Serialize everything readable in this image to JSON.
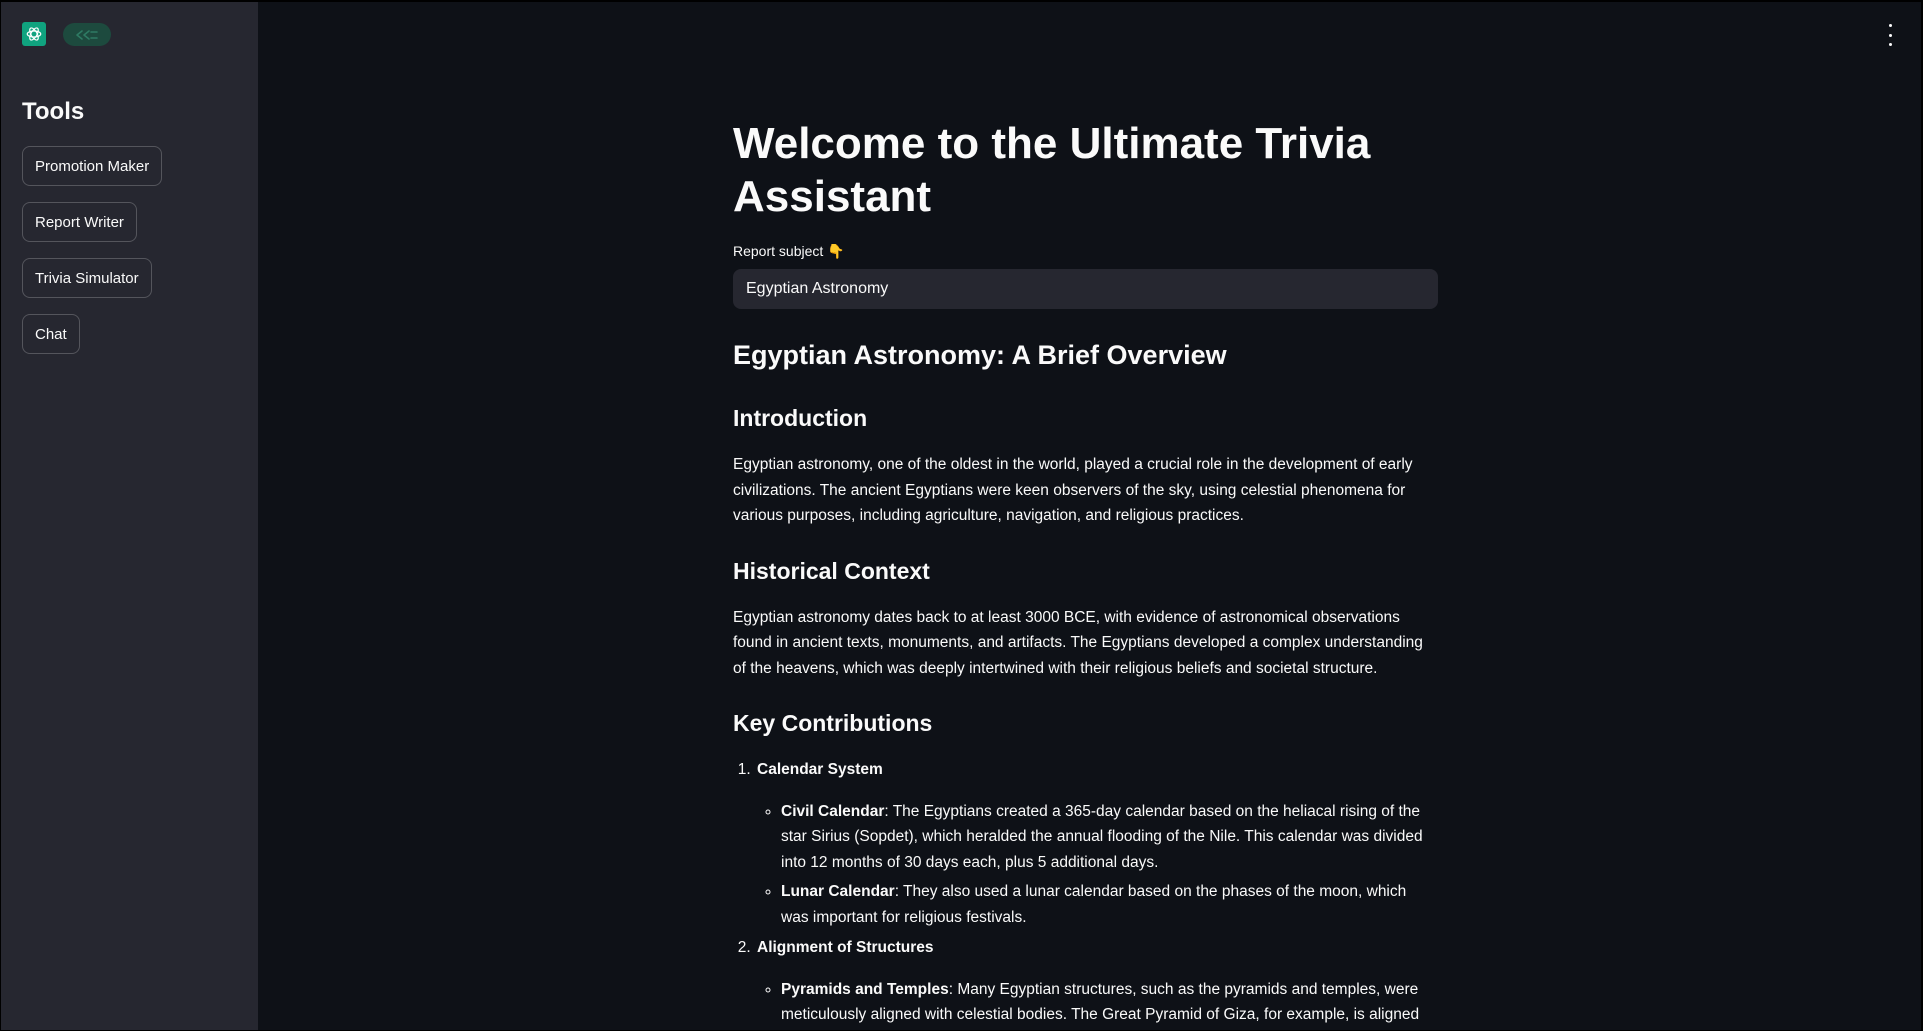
{
  "sidebar": {
    "title": "Tools",
    "buttons": [
      {
        "label": "Promotion Maker"
      },
      {
        "label": "Report Writer"
      },
      {
        "label": "Trivia Simulator"
      },
      {
        "label": "Chat"
      }
    ]
  },
  "main": {
    "title": "Welcome to the Ultimate Trivia Assistant",
    "input_label": "Report subject 👇",
    "input_value": "Egyptian Astronomy"
  },
  "report": {
    "heading": "Egyptian Astronomy: A Brief Overview",
    "sections": [
      {
        "heading": "Introduction",
        "body": "Egyptian astronomy, one of the oldest in the world, played a crucial role in the development of early civilizations. The ancient Egyptians were keen observers of the sky, using celestial phenomena for various purposes, including agriculture, navigation, and religious practices."
      },
      {
        "heading": "Historical Context",
        "body": "Egyptian astronomy dates back to at least 3000 BCE, with evidence of astronomical observations found in ancient texts, monuments, and artifacts. The Egyptians developed a complex understanding of the heavens, which was deeply intertwined with their religious beliefs and societal structure."
      }
    ],
    "contributions": {
      "heading": "Key Contributions",
      "items": [
        {
          "title": "Calendar System",
          "points": [
            {
              "term": "Civil Calendar",
              "text": ": The Egyptians created a 365-day calendar based on the heliacal rising of the star Sirius (Sopdet), which heralded the annual flooding of the Nile. This calendar was divided into 12 months of 30 days each, plus 5 additional days."
            },
            {
              "term": "Lunar Calendar",
              "text": ": They also used a lunar calendar based on the phases of the moon, which was important for religious festivals."
            }
          ]
        },
        {
          "title": "Alignment of Structures",
          "points": [
            {
              "term": "Pyramids and Temples",
              "text": ": Many Egyptian structures, such as the pyramids and temples, were meticulously aligned with celestial bodies. The Great Pyramid of Giza, for example, is aligned with the cardinal points, and its internal shafts are aligned with specific stars."
            }
          ]
        }
      ]
    }
  },
  "icons": {
    "app_logo": "openai-logo-icon",
    "collapse": "sidebar-collapse-icon",
    "menu": "kebab-menu-icon"
  },
  "colors": {
    "background": "#0e1117",
    "sidebar": "#262730",
    "text": "#fafafa",
    "logo": "#10a37f"
  }
}
